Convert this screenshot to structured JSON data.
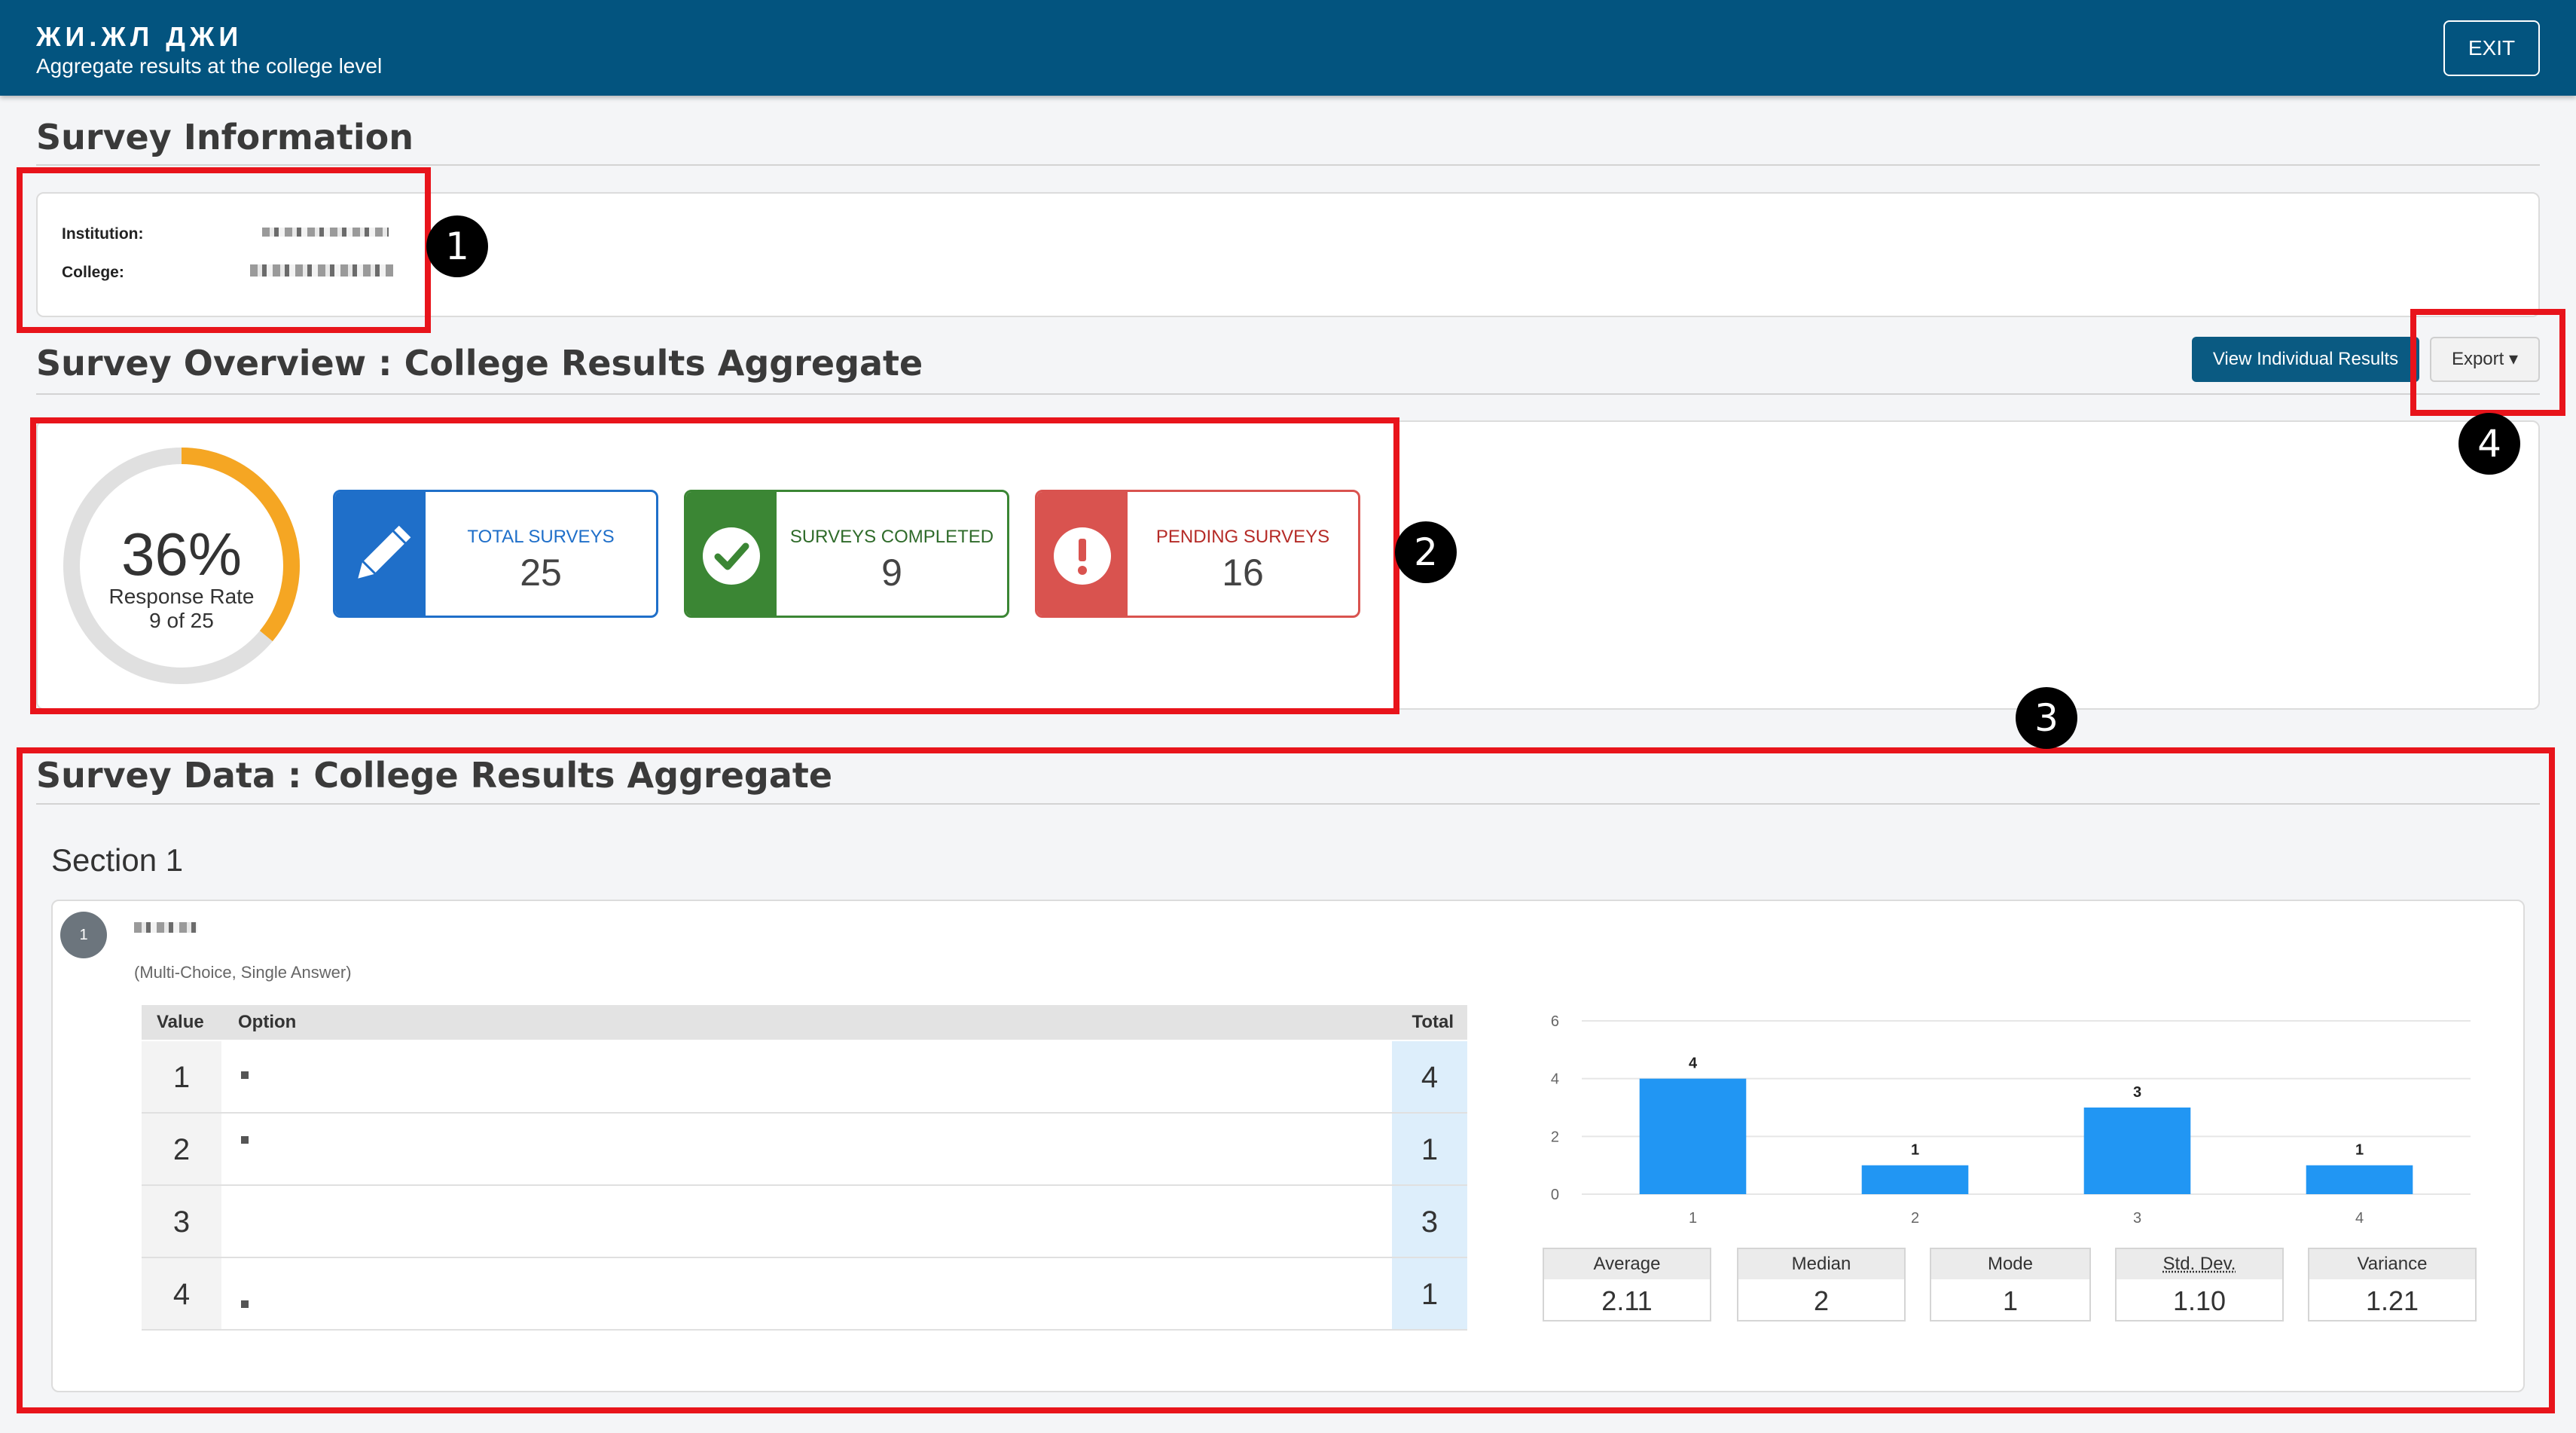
{
  "header": {
    "title": "ЖИ.ЖЛ ДЖИ",
    "subtitle": "Aggregate results at the college level",
    "exit_label": "EXIT"
  },
  "survey_information": {
    "heading": "Survey Information",
    "institution_label": "Institution:",
    "college_label": "College:"
  },
  "overview": {
    "heading": "Survey Overview : College Results Aggregate",
    "view_individual_label": "View Individual Results",
    "export_label": "Export ▾",
    "response_rate": {
      "percent_text": "36%",
      "fraction": 0.36,
      "label": "Response Rate",
      "detail": "9 of 25"
    },
    "cards": [
      {
        "label": "TOTAL SURVEYS",
        "value": "25",
        "icon": "pencil-icon",
        "color": "#1f6fc9"
      },
      {
        "label": "SURVEYS COMPLETED",
        "value": "9",
        "icon": "check-circle-icon",
        "color": "#3b8634"
      },
      {
        "label": "PENDING SURVEYS",
        "value": "16",
        "icon": "exclamation-circle-icon",
        "color": "#d9534f"
      }
    ]
  },
  "survey_data": {
    "heading": "Survey Data : College Results Aggregate",
    "section_title": "Section 1",
    "question": {
      "number": "1",
      "type": "(Multi-Choice, Single Answer)",
      "columns": {
        "value": "Value",
        "option": "Option",
        "total": "Total"
      },
      "rows": [
        {
          "value": "1",
          "total": "4"
        },
        {
          "value": "2",
          "total": "1"
        },
        {
          "value": "3",
          "total": "3"
        },
        {
          "value": "4",
          "total": "1"
        }
      ],
      "stats": [
        {
          "label": "Average",
          "value": "2.11"
        },
        {
          "label": "Median",
          "value": "2"
        },
        {
          "label": "Mode",
          "value": "1"
        },
        {
          "label": "Std. Dev.",
          "value": "1.10"
        },
        {
          "label": "Variance",
          "value": "1.21"
        }
      ]
    }
  },
  "annotations": [
    "1",
    "2",
    "3",
    "4"
  ],
  "colors": {
    "header_bg": "#03547f",
    "highlight_red": "#e8141b",
    "bar_blue": "#2196f3",
    "donut_orange": "#f5a623",
    "donut_track": "#e0e0e0"
  },
  "chart_data": {
    "type": "bar",
    "categories": [
      "1",
      "2",
      "3",
      "4"
    ],
    "values": [
      4,
      1,
      3,
      1
    ],
    "data_labels": [
      "4",
      "1",
      "3",
      "1"
    ],
    "ylim": [
      0,
      6
    ],
    "yticks": [
      "0",
      "2",
      "4",
      "6"
    ],
    "grid": true,
    "title": "",
    "xlabel": "",
    "ylabel": ""
  }
}
